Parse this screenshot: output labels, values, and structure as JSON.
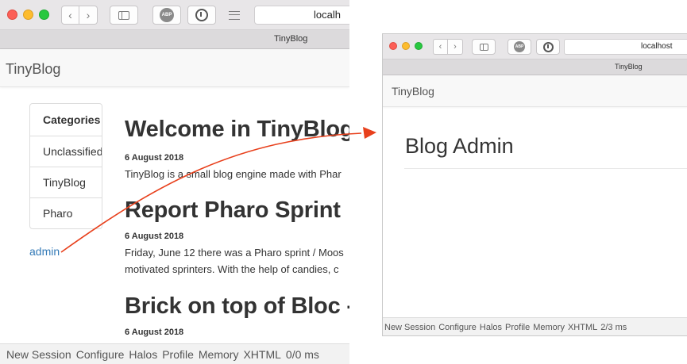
{
  "left_window": {
    "url": "localh",
    "tab_title": "TinyBlog",
    "brand": "TinyBlog",
    "categories": {
      "heading": "Categories",
      "items": [
        {
          "label": "Unclassified"
        },
        {
          "label": "TinyBlog"
        },
        {
          "label": "Pharo"
        }
      ]
    },
    "admin_link": "admin",
    "posts": [
      {
        "title": "Welcome in TinyBlog",
        "date": "6 August 2018",
        "lines": [
          "TinyBlog is a small blog engine made with Phar"
        ]
      },
      {
        "title": "Report Pharo Sprint",
        "date": "6 August 2018",
        "lines": [
          "Friday, June 12 there was a Pharo sprint / Moos",
          "motivated sprinters. With the help of candies, c"
        ]
      },
      {
        "title": "Brick on top of Bloc -",
        "date": "6 August 2018",
        "lines": []
      }
    ],
    "statusbar": [
      "New Session",
      "Configure",
      "Halos",
      "Profile",
      "Memory",
      "XHTML",
      "0/0 ms"
    ]
  },
  "right_window": {
    "url": "localhost",
    "tab_title": "TinyBlog",
    "brand": "TinyBlog",
    "page_title": "Blog Admin",
    "statusbar": [
      "New Session",
      "Configure",
      "Halos",
      "Profile",
      "Memory",
      "XHTML",
      "2/3 ms"
    ]
  },
  "toolbar_icons": {
    "back": "chevron-left-icon",
    "forward": "chevron-right-icon",
    "sidebar": "sidebar-icon",
    "adblock": "abp-icon",
    "info": "info-icon",
    "reader": "reader-icon",
    "abp_text": "ABP"
  },
  "colors": {
    "link": "#337ab7",
    "arrow": "#e8401c",
    "traffic_red": "#fc5f57",
    "traffic_yellow": "#fdbc2e",
    "traffic_green": "#28c840"
  }
}
